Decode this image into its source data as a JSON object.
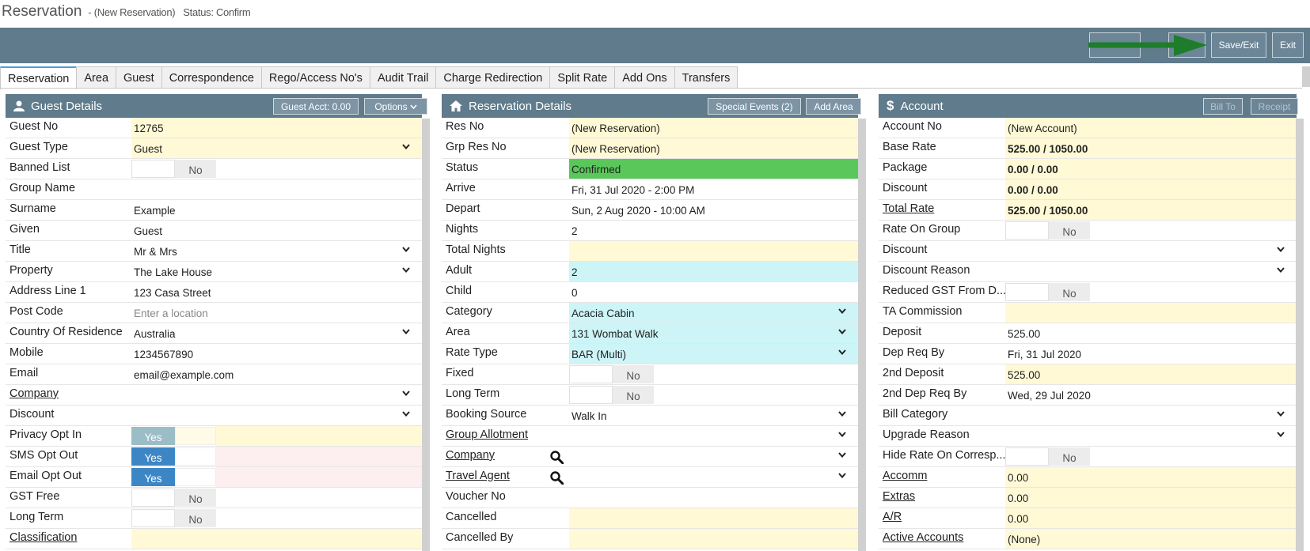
{
  "title": {
    "main": "Reservation",
    "sub": "- (New Reservation)",
    "status": "Status: Confirm"
  },
  "toolbar": {
    "save_exit": "Save/Exit",
    "exit": "Exit"
  },
  "tabs": [
    "Reservation",
    "Area",
    "Guest",
    "Correspondence",
    "Rego/Access No's",
    "Audit Trail",
    "Charge Redirection",
    "Split Rate",
    "Add Ons",
    "Transfers"
  ],
  "guest": {
    "title": "Guest Details",
    "acct_btn": "Guest Acct: 0.00",
    "options_btn": "Options",
    "rows": [
      {
        "label": "Guest No",
        "value": "12765"
      },
      {
        "label": "Guest Type",
        "value": "Guest"
      },
      {
        "label": "Banned List",
        "value": "No"
      },
      {
        "label": "Group Name",
        "value": ""
      },
      {
        "label": "Surname",
        "value": "Example"
      },
      {
        "label": "Given",
        "value": "Guest"
      },
      {
        "label": "Title",
        "value": "Mr & Mrs"
      },
      {
        "label": "Property",
        "value": "The Lake House"
      },
      {
        "label": "Address Line 1",
        "value": "123 Casa Street"
      },
      {
        "label": "Post Code",
        "value": "Enter a location"
      },
      {
        "label": "Country Of Residence",
        "value": "Australia"
      },
      {
        "label": "Mobile",
        "value": "1234567890"
      },
      {
        "label": "Email",
        "value": "email@example.com"
      },
      {
        "label": "Company",
        "value": ""
      },
      {
        "label": "Discount",
        "value": ""
      },
      {
        "label": "Privacy Opt In",
        "value": "Yes"
      },
      {
        "label": "SMS Opt Out",
        "value": "Yes"
      },
      {
        "label": "Email Opt Out",
        "value": "Yes"
      },
      {
        "label": "GST Free",
        "value": "No"
      },
      {
        "label": "Long Term",
        "value": "No"
      },
      {
        "label": "Classification",
        "value": ""
      }
    ]
  },
  "res": {
    "title": "Reservation Details",
    "special_btn": "Special Events (2)",
    "area_btn": "Add Area",
    "rows": [
      {
        "label": "Res No",
        "value": "(New Reservation)"
      },
      {
        "label": "Grp Res No",
        "value": "(New Reservation)"
      },
      {
        "label": "Status",
        "value": "Confirmed"
      },
      {
        "label": "Arrive",
        "value": "Fri, 31 Jul 2020 - 2:00 PM"
      },
      {
        "label": "Depart",
        "value": "Sun, 2 Aug 2020 - 10:00 AM"
      },
      {
        "label": "Nights",
        "value": "2"
      },
      {
        "label": "Total Nights",
        "value": ""
      },
      {
        "label": "Adult",
        "value": "2"
      },
      {
        "label": "Child",
        "value": "0"
      },
      {
        "label": "Category",
        "value": "Acacia Cabin"
      },
      {
        "label": "Area",
        "value": "131 Wombat Walk"
      },
      {
        "label": "Rate Type",
        "value": "BAR (Multi)"
      },
      {
        "label": "Fixed",
        "value": "No"
      },
      {
        "label": "Long Term",
        "value": "No"
      },
      {
        "label": "Booking Source",
        "value": "Walk In"
      },
      {
        "label": "Group Allotment",
        "value": ""
      },
      {
        "label": "Company",
        "value": ""
      },
      {
        "label": "Travel Agent",
        "value": ""
      },
      {
        "label": "Voucher No",
        "value": ""
      },
      {
        "label": "Cancelled",
        "value": ""
      },
      {
        "label": "Cancelled By",
        "value": ""
      }
    ]
  },
  "acct": {
    "title": "Account",
    "bill_btn": "Bill To",
    "receipt_btn": "Receipt",
    "rows": [
      {
        "label": "Account No",
        "value": "(New Account)"
      },
      {
        "label": "Base Rate",
        "value": "525.00 / 1050.00"
      },
      {
        "label": "Package",
        "value": "0.00 / 0.00"
      },
      {
        "label": "Discount",
        "value": "0.00 / 0.00"
      },
      {
        "label": "Total Rate",
        "value": "525.00 / 1050.00"
      },
      {
        "label": "Rate On Group",
        "value": "No"
      },
      {
        "label": "Discount",
        "value": ""
      },
      {
        "label": "Discount Reason",
        "value": ""
      },
      {
        "label": "Reduced GST From D...",
        "value": "No"
      },
      {
        "label": "TA Commission",
        "value": ""
      },
      {
        "label": "Deposit",
        "value": "525.00"
      },
      {
        "label": "Dep Req By",
        "value": "Fri, 31 Jul 2020"
      },
      {
        "label": "2nd Deposit",
        "value": "525.00"
      },
      {
        "label": "2nd Dep Req By",
        "value": "Wed, 29 Jul 2020"
      },
      {
        "label": "Bill Category",
        "value": ""
      },
      {
        "label": "Upgrade Reason",
        "value": ""
      },
      {
        "label": "Hide Rate On Corresp...",
        "value": "No"
      },
      {
        "label": "Accomm",
        "value": "0.00"
      },
      {
        "label": "Extras",
        "value": "0.00"
      },
      {
        "label": "A/R",
        "value": "0.00"
      },
      {
        "label": "Active Accounts",
        "value": "(None)"
      }
    ]
  }
}
